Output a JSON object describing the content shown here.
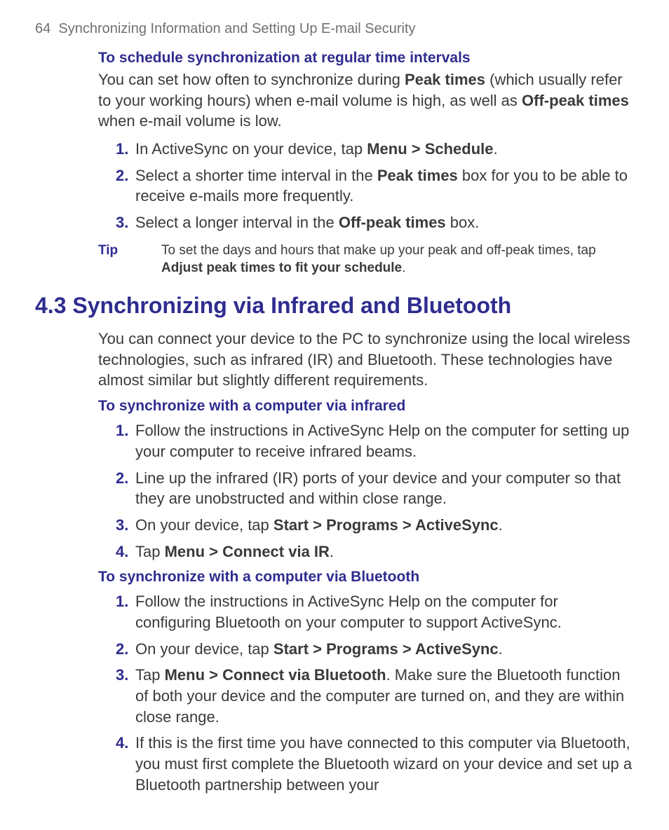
{
  "header": {
    "page_number": "64",
    "chapter_title": "Synchronizing Information and Setting Up E-mail Security"
  },
  "section1": {
    "heading": "To schedule synchronization at regular time intervals",
    "intro_pre": "You can set how often to synchronize during ",
    "intro_b1": "Peak times",
    "intro_mid": " (which usually refer to your working hours) when e-mail volume is high, as well as ",
    "intro_b2": "Off-peak times",
    "intro_post": " when e-mail volume is low.",
    "steps": {
      "s1": {
        "num": "1.",
        "pre": "In ActiveSync on your device, tap ",
        "b": "Menu > Schedule",
        "post": "."
      },
      "s2": {
        "num": "2.",
        "pre": "Select a shorter time interval in the ",
        "b": "Peak times",
        "post": " box for you to be able to receive e-mails more frequently."
      },
      "s3": {
        "num": "3.",
        "pre": "Select a longer interval in the ",
        "b": "Off-peak times",
        "post": " box."
      }
    },
    "tip": {
      "label": "Tip",
      "pre": "To set the days and hours that make up your peak and off-peak times, tap ",
      "b": "Adjust peak times to fit your schedule",
      "post": "."
    }
  },
  "section2": {
    "title": "4.3 Synchronizing via Infrared and Bluetooth",
    "intro": "You can connect your device to the PC to synchronize using the local wireless technologies, such as infrared (IR) and Bluetooth. These technologies have almost similar but slightly different requirements.",
    "sub_ir": {
      "heading": "To synchronize with a computer via infrared",
      "steps": {
        "s1": {
          "num": "1.",
          "text": "Follow the instructions in ActiveSync Help on the computer for setting up your computer to receive infrared beams."
        },
        "s2": {
          "num": "2.",
          "text": "Line up the infrared (IR) ports of your device and your computer so that they are unobstructed and within close range."
        },
        "s3": {
          "num": "3.",
          "pre": "On your device, tap ",
          "b": "Start > Programs > ActiveSync",
          "post": "."
        },
        "s4": {
          "num": "4.",
          "pre": "Tap ",
          "b": "Menu > Connect via IR",
          "post": "."
        }
      }
    },
    "sub_bt": {
      "heading": "To synchronize with a computer via Bluetooth",
      "steps": {
        "s1": {
          "num": "1.",
          "text": "Follow the instructions in ActiveSync Help on the computer for configuring Bluetooth on your computer to support ActiveSync."
        },
        "s2": {
          "num": "2.",
          "pre": "On your device, tap ",
          "b": "Start > Programs > ActiveSync",
          "post": "."
        },
        "s3": {
          "num": "3.",
          "pre": "Tap ",
          "b": "Menu > Connect via Bluetooth",
          "post": ". Make sure the Bluetooth function of both your device and the computer are turned on, and they are within close range."
        },
        "s4": {
          "num": "4.",
          "text": "If this is the first time you have connected to this computer via Bluetooth, you must first complete the Bluetooth wizard on your device and set up a Bluetooth partnership between your"
        }
      }
    }
  }
}
